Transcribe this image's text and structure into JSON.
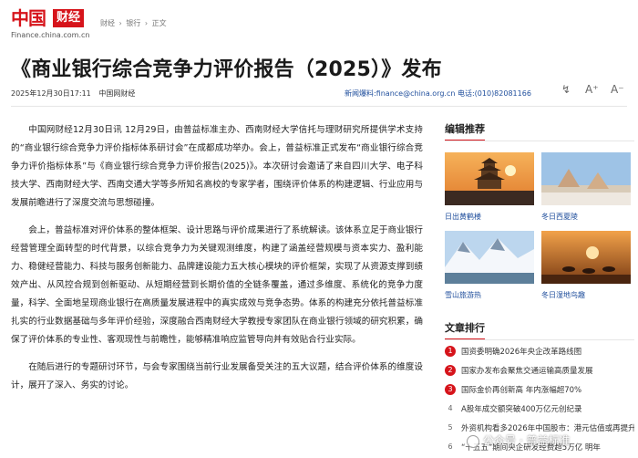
{
  "header": {
    "logo_cn": "中国",
    "logo_box": "财经",
    "logo_url": "Finance.china.com.cn",
    "breadcrumb": [
      "财经",
      "›",
      "银行",
      "›",
      "正文"
    ]
  },
  "article": {
    "title": "《商业银行综合竞争力评价报告（2025）》发布",
    "date": "2025年12月30日17:11",
    "source": "中国网财经",
    "hotline": "新闻爆料:finance@china.org.cn 电话:(010)82081166",
    "paragraphs": [
      "中国网财经12月30日讯 12月29日，由普益标准主办、西南财经大学信托与理财研究所提供学术支持的“商业银行综合竞争力评价指标体系研讨会”在成都成功举办。会上，普益标准正式发布“商业银行综合竞争力评价指标体系”与《商业银行综合竞争力评价报告(2025)》。本次研讨会邀请了来自四川大学、电子科技大学、西南财经大学、西南交通大学等多所知名高校的专家学者，围绕评价体系的构建逻辑、行业应用与发展前瞻进行了深度交流与思想碰撞。",
      "会上，普益标准对评价体系的整体框架、设计思路与评价成果进行了系统解读。该体系立足于商业银行经营管理全面转型的时代背景，以综合竞争力为关键观测维度，构建了涵盖经营规模与资本实力、盈利能力、稳健经营能力、科技与服务创新能力、品牌建设能力五大核心模块的评价框架，实现了从资源支撑到绩效产出、从风控合规到创新驱动、从短期经营到长期价值的全链条覆盖，通过多维度、系统化的竞争力度量，科学、全面地呈现商业银行在高质量发展进程中的真实成效与竞争态势。体系的构建充分依托普益标准扎实的行业数据基础与多年评价经验，深度融合西南财经大学教授专家团队在商业银行领域的研究积累，确保了评价体系的专业性、客观现性与前瞻性，能够精准响应监管导向并有效贴合行业实际。",
      "在随后进行的专题研讨环节，与会专家围绕当前行业发展备受关注的五大议题，结合评价体系的维度设计，展开了深入、务实的讨论。"
    ]
  },
  "tools": {
    "share": "↯",
    "font_up": "A⁺",
    "font_down": "A⁻"
  },
  "sidebar": {
    "editor_title": "编辑推荐",
    "picks": [
      {
        "caption": "日出黄鹤楼"
      },
      {
        "caption": "冬日西夏陵"
      },
      {
        "caption": "雪山旅游热"
      },
      {
        "caption": "冬日湿地鸟趣"
      }
    ],
    "rank_title": "文章排行",
    "ranks": [
      {
        "num": "1",
        "text": "国资委明确2026年央企改革路线图"
      },
      {
        "num": "2",
        "text": "国家办发布会聚焦交通运输高质量发展"
      },
      {
        "num": "3",
        "text": "国际金价再创新高 年内涨幅超70%"
      },
      {
        "num": "4",
        "text": "A股年成交额突破400万亿元创纪录"
      },
      {
        "num": "5",
        "text": "外资机构看多2026年中国股市：港元估值或再提升"
      },
      {
        "num": "6",
        "text": "“十五五”期间央企研发经费超5万亿 明年"
      }
    ]
  },
  "watermark": {
    "text": "公众号 · 普益标准"
  },
  "colors": {
    "brand_red": "#d6141b",
    "link_blue": "#1f4e9c"
  }
}
